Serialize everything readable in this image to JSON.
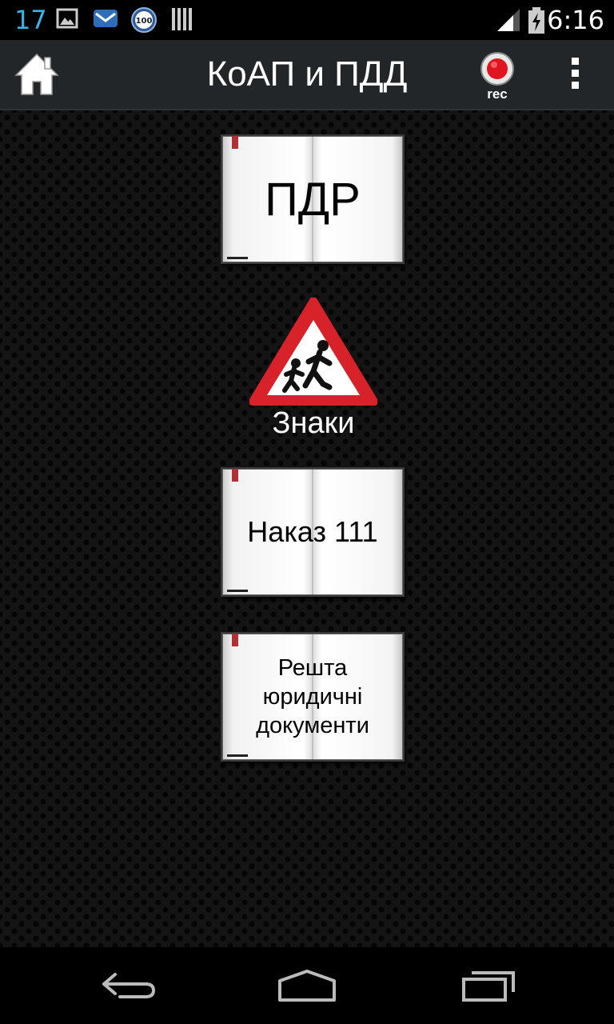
{
  "status_bar": {
    "notification_count": "17",
    "icons": [
      "image-icon",
      "mail-icon",
      "badge-100-icon",
      "barcode-icon",
      "signal-icon",
      "battery-charging-icon"
    ],
    "badge_text": "100",
    "time": "6:16"
  },
  "action_bar": {
    "title": "КоАП и ПДД",
    "home_icon": "home-icon",
    "rec_label": "rec",
    "overflow_icon": "overflow-menu-icon"
  },
  "menu": {
    "pdr_label": "ПДР",
    "signs_label": "Знаки",
    "nakaz_label": "Наказ 111",
    "reshta_lines": [
      "Решта",
      "юридичні",
      "документи"
    ]
  },
  "nav_bar": {
    "icons": [
      "back-icon",
      "home-nav-icon",
      "recent-apps-icon"
    ]
  },
  "colors": {
    "accent_blue": "#33b5e5",
    "action_bar": "#232629",
    "sign_red": "#d8222a",
    "rec_red": "#e0151f"
  }
}
